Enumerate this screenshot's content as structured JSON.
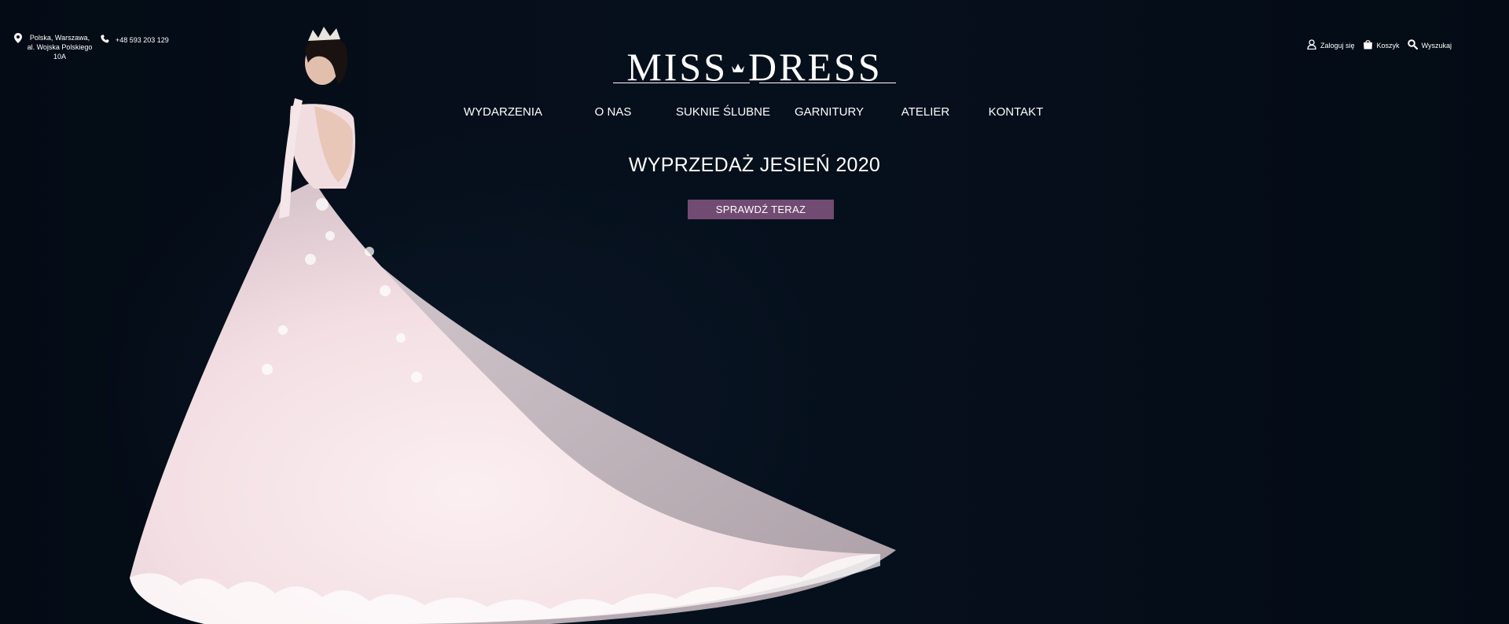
{
  "contact": {
    "address_lines": [
      "Polska, Warszawa,",
      "al. Wojska Polskiego",
      "10A"
    ],
    "phone": "+48 593 203 129",
    "address_icon": "map-pin-icon",
    "phone_icon": "phone-icon"
  },
  "account": {
    "login_label": "Zaloguj się",
    "cart_label": "Koszyk",
    "search_label": "Wyszukaj"
  },
  "logo": {
    "left": "MISS",
    "right": "DRESS",
    "crown_icon": "crown-icon"
  },
  "nav": {
    "items": [
      {
        "label": "WYDARZENIA"
      },
      {
        "label": "O NAS"
      },
      {
        "label": "SUKNIE ŚLUBNE"
      },
      {
        "label": "GARNITURY"
      },
      {
        "label": "ATELIER"
      },
      {
        "label": "KONTAKT"
      }
    ]
  },
  "hero": {
    "headline": "WYPRZEDAŻ JESIEŃ 2020",
    "cta_label": "SPRAWDŹ TERAZ"
  },
  "colors": {
    "background": "#050d18",
    "cta": "#714b72",
    "text": "#ffffff"
  }
}
